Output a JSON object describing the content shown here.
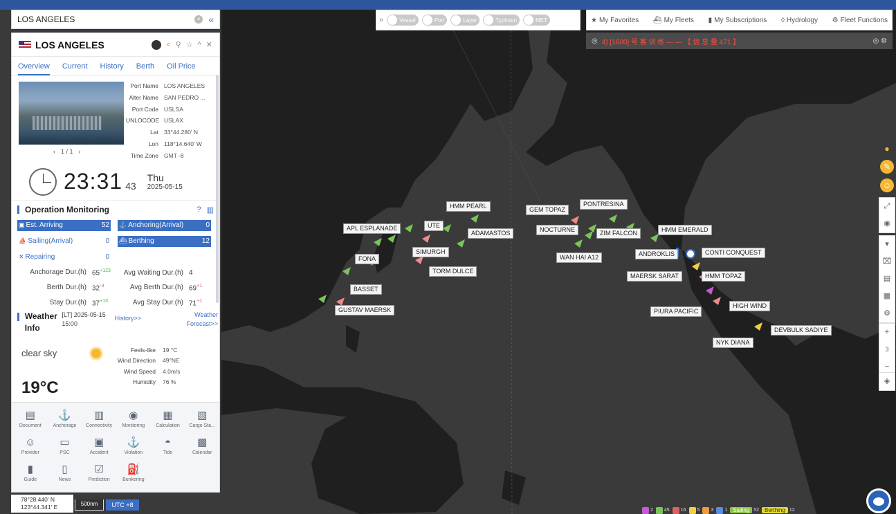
{
  "search": {
    "value": "LOS ANGELES"
  },
  "port_panel": {
    "title": "LOS ANGELES",
    "tabs": [
      "Overview",
      "Current",
      "History",
      "Berth",
      "Oil Price"
    ],
    "active_tab": "Overview",
    "attributes": [
      {
        "key": "Port Name",
        "value": "LOS ANGELES"
      },
      {
        "key": "Alter Name",
        "value": "SAN PEDRO ..."
      },
      {
        "key": "Port Code",
        "value": "USLSA"
      },
      {
        "key": "UNLOCODE",
        "value": "USLAX"
      },
      {
        "key": "Lat",
        "value": "33°44.280' N"
      },
      {
        "key": "Lon",
        "value": "118°14.640' W"
      },
      {
        "key": "Time Zone",
        "value": "GMT -8"
      }
    ],
    "photo_pager": "1 / 1",
    "clock": {
      "time": "23:31",
      "seconds": "43",
      "day": "Thu",
      "date": "2025-05-15"
    }
  },
  "operation": {
    "title": "Operation Monitoring",
    "counts": [
      [
        {
          "label": "Est. Arriving",
          "value": "52",
          "icon": "calendar-icon",
          "highlight": true
        },
        {
          "label": "Anchoring(Arrival)",
          "value": "0",
          "icon": "anchor-icon",
          "highlight": true
        }
      ],
      [
        {
          "label": "Sailing(Arrival)",
          "value": "0",
          "icon": "ship-icon",
          "highlight": false
        },
        {
          "label": "Berthing",
          "value": "12",
          "icon": "berth-icon",
          "highlight": true
        }
      ],
      [
        {
          "label": "Repairing",
          "value": "0",
          "icon": "wrench-icon",
          "highlight": false
        }
      ]
    ],
    "durations": [
      [
        {
          "key": "Anchorage Dur.(h)",
          "value": "65",
          "delta": "+123",
          "delta_color": "green"
        },
        {
          "key": "Avg Waiting Dur.(h)",
          "value": "4",
          "delta": "",
          "delta_color": ""
        }
      ],
      [
        {
          "key": "Berth Dur.(h)",
          "value": "32",
          "delta": "-3",
          "delta_color": "red"
        },
        {
          "key": "Avg Berth Dur.(h)",
          "value": "69",
          "delta": "+1",
          "delta_color": "red"
        }
      ],
      [
        {
          "key": "Stay Dur.(h)",
          "value": "37",
          "delta": "+13",
          "delta_color": "green"
        },
        {
          "key": "Avg Stay Dur.(h)",
          "value": "71",
          "delta": "+1",
          "delta_color": "red"
        }
      ]
    ]
  },
  "weather": {
    "title": "Weather Info",
    "local_time": "[LT] 2025-05-15 15:00",
    "history_link": "History>>",
    "forecast_link": "Weather Forecast>>",
    "condition": "clear sky",
    "temperature": "19°C",
    "details": [
      {
        "key": "Feels-like",
        "value": "19 °C"
      },
      {
        "key": "Wind Direction",
        "value": "49°NE"
      },
      {
        "key": "Wind Speed",
        "value": "4.0m/s"
      },
      {
        "key": "Humidity",
        "value": "76 %"
      }
    ]
  },
  "tools": [
    {
      "label": "Document",
      "icon": "document-icon",
      "glyph": "▤"
    },
    {
      "label": "Anchorage",
      "icon": "anchorage-icon",
      "glyph": "⚓"
    },
    {
      "label": "Connectivity",
      "icon": "connectivity-icon",
      "glyph": "▥"
    },
    {
      "label": "Monitoring",
      "icon": "globe-icon",
      "glyph": "◉"
    },
    {
      "label": "Calculation",
      "icon": "calculation-icon",
      "glyph": "▦"
    },
    {
      "label": "Cargo Sta...",
      "icon": "cargo-icon",
      "glyph": "▧"
    },
    {
      "label": "Provider",
      "icon": "provider-icon",
      "glyph": "☺"
    },
    {
      "label": "PSC",
      "icon": "psc-icon",
      "glyph": "▭"
    },
    {
      "label": "Accident",
      "icon": "accident-icon",
      "glyph": "▣"
    },
    {
      "label": "Violation",
      "icon": "violation-icon",
      "glyph": "⚓"
    },
    {
      "label": "Tide",
      "icon": "tide-icon",
      "glyph": "◓"
    },
    {
      "label": "Calendar",
      "icon": "calendar-icon",
      "glyph": "▩"
    },
    {
      "label": "Guide",
      "icon": "guide-icon",
      "glyph": "▮"
    },
    {
      "label": "News",
      "icon": "news-icon",
      "glyph": "▯"
    },
    {
      "label": "Prediction",
      "icon": "prediction-icon",
      "glyph": "☑"
    },
    {
      "label": "Bunkering",
      "icon": "bunkering-icon",
      "glyph": "⛽"
    }
  ],
  "layers": [
    "Vessel",
    "Port",
    "Layer",
    "Typhoon",
    "MET"
  ],
  "topnav": [
    {
      "label": "My Favorites",
      "icon": "star-icon",
      "glyph": "★"
    },
    {
      "label": "My Fleets",
      "icon": "fleet-icon",
      "glyph": "⛴"
    },
    {
      "label": "My Subscriptions",
      "icon": "bookmark-icon",
      "glyph": "▮"
    },
    {
      "label": "Hydrology",
      "icon": "hydrology-icon",
      "glyph": "◊"
    },
    {
      "label": "Fleet Functions",
      "icon": "fleet-functions-icon",
      "glyph": "⚙"
    }
  ],
  "notice": "4) [1600] 号 客 训 练 — — 【 信 息 量 471 】",
  "map": {
    "vessels": [
      "HMM PEARL",
      "APL ESPLANADE",
      "UTE",
      "ADAMASTOS",
      "SIMURGH",
      "TORM DULCE",
      "FONA",
      "BASSET",
      "GUSTAV MAERSK",
      "GEM TOPAZ",
      "PONTRESINA",
      "NOCTURNE",
      "ZIM FALCON",
      "WAN HAI A12",
      "HMM EMERALD",
      "ANDROKLIS",
      "CONTI CONQUEST",
      "MAERSK SARAT",
      "HMM TOPAZ",
      "HIGH WIND",
      "PIURA PACIFIC",
      "DEVBULK SADIYE",
      "NYK DIANA"
    ]
  },
  "zoom": {
    "plus": "+",
    "level": "3",
    "minus": "−"
  },
  "coords": {
    "lat": "78°28.440' N",
    "lon": "123°44.341' E"
  },
  "scale": "500nm",
  "utc": "UTC +8",
  "legend": {
    "counts": [
      {
        "value": "2",
        "color": "#c85ad6"
      },
      {
        "value": "45",
        "color": "#7ac55a"
      },
      {
        "value": "16",
        "color": "#e06060"
      },
      {
        "value": "5",
        "color": "#f0d040"
      },
      {
        "value": "3",
        "color": "#f09a40"
      },
      {
        "value": "1",
        "color": "#5a8de0"
      }
    ],
    "sailing": "Sailing",
    "sailing_count": "52",
    "berthing": "Berthing",
    "berthing_count": "12"
  },
  "colors": {
    "accent": "#3b6fc4",
    "ocean": "#3a3a3a",
    "land": "#1f1f1f"
  }
}
